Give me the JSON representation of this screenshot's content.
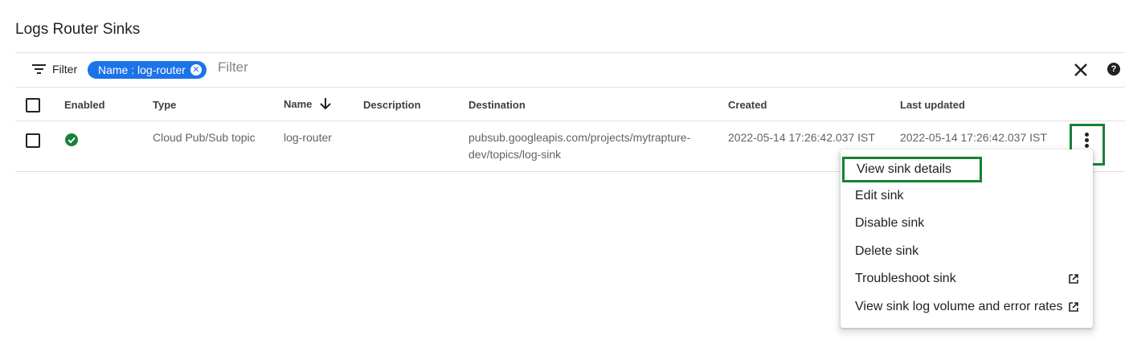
{
  "page": {
    "title": "Logs Router Sinks"
  },
  "filter_bar": {
    "filter_label": "Filter",
    "chip_label": "Name : log-router",
    "placeholder": "Filter"
  },
  "table": {
    "headers": {
      "enabled": "Enabled",
      "type": "Type",
      "name": "Name",
      "description": "Description",
      "destination": "Destination",
      "created": "Created",
      "last_updated": "Last updated"
    },
    "rows": [
      {
        "type": "Cloud Pub/Sub topic",
        "name": "log-router",
        "description": "",
        "destination_line1": "pubsub.googleapis.com/projects/mytrapture-",
        "destination_line2": "dev/topics/log-sink",
        "created": "2022-05-14 17:26:42.037 IST",
        "last_updated": "2022-05-14 17:26:42.037 IST"
      }
    ]
  },
  "menu": {
    "items": [
      {
        "label": "View sink details"
      },
      {
        "label": "Edit sink"
      },
      {
        "label": "Disable sink"
      },
      {
        "label": "Delete sink"
      },
      {
        "label": "Troubleshoot sink"
      },
      {
        "label": "View sink log volume and error rates"
      }
    ]
  },
  "colors": {
    "accent": "#1a73e8",
    "success": "#188038",
    "highlight_border": "#188038"
  }
}
